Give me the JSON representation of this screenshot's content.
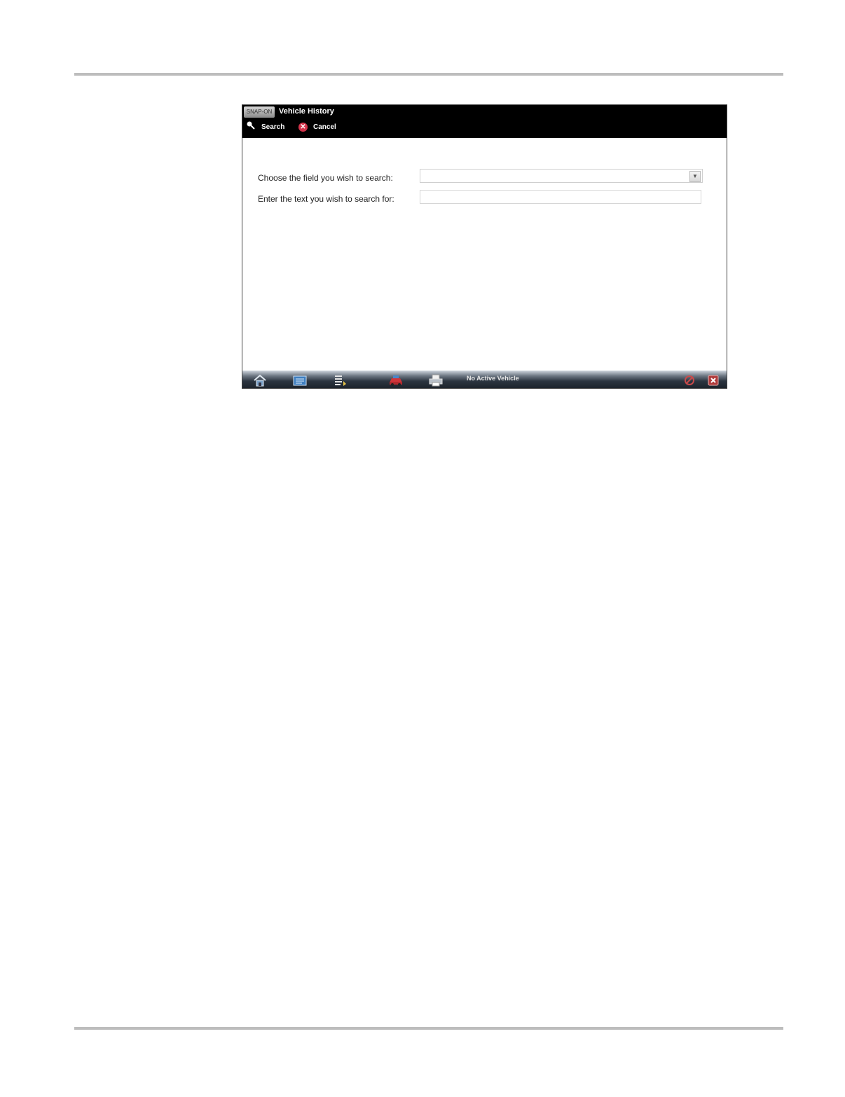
{
  "header": {
    "logo_text": "SNAP-ON",
    "title": "Vehicle History",
    "toolbar": {
      "search_label": "Search",
      "cancel_label": "Cancel"
    }
  },
  "form": {
    "field_label": "Choose the field you wish to search:",
    "field_value": "",
    "text_label": "Enter the text you wish to search for:",
    "text_value": ""
  },
  "taskbar": {
    "status": "No Active Vehicle",
    "icons": [
      "home-icon",
      "screen-icon",
      "list-icon",
      "vehicle-icon",
      "printer-icon",
      "scope-icon",
      "exit-icon"
    ]
  }
}
